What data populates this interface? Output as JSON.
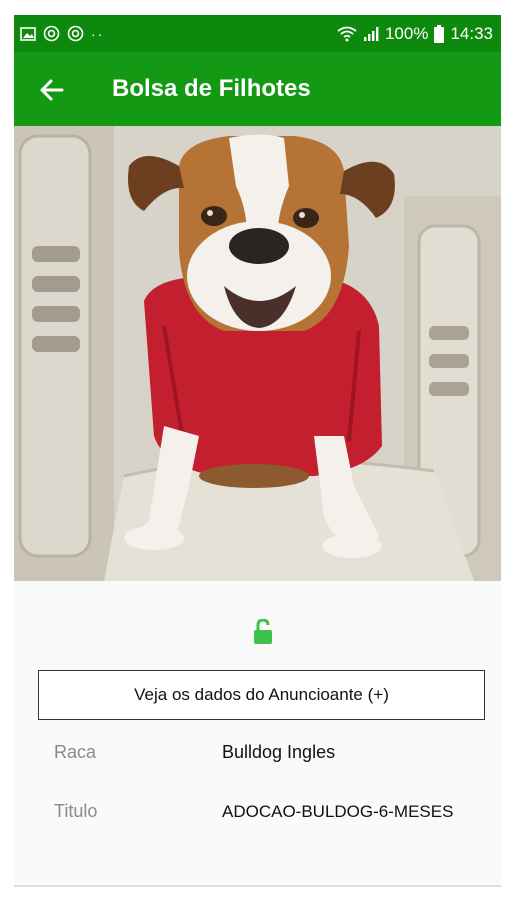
{
  "status_bar": {
    "battery": "100%",
    "time": "14:33"
  },
  "app_bar": {
    "title": "Bolsa de Filhotes"
  },
  "advertiser_button": {
    "label": "Veja os dados do Anuncioante (+)"
  },
  "details": [
    {
      "label": "Raca",
      "value": "Bulldog Ingles"
    },
    {
      "label": "Titulo",
      "value": "ADOCAO-BULDOG-6-MESES"
    }
  ],
  "colors": {
    "status_bar": "#0d8a0d",
    "app_bar": "#139913",
    "lock_icon": "#3ec24a"
  },
  "icons": [
    "image-icon",
    "sync-icon",
    "sync-icon",
    "wifi-icon",
    "signal-icon",
    "battery-icon",
    "back-arrow-icon",
    "unlock-icon"
  ]
}
